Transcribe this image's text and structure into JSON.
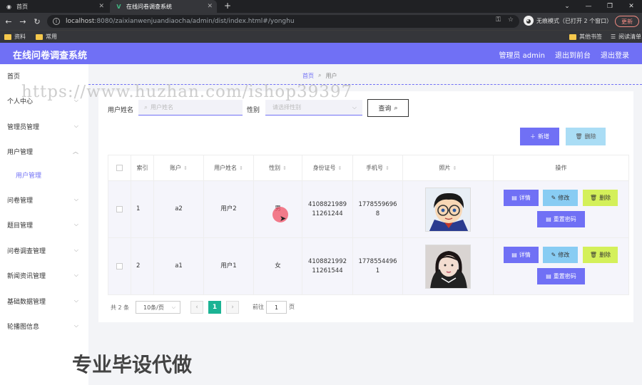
{
  "browser": {
    "tabs": [
      {
        "title": "首页"
      },
      {
        "title": "在线问卷调查系统"
      }
    ],
    "url_host": "localhost",
    "url_rest": ":8080/zaixianwenjuandiaocha/admin/dist/index.html#/yonghu",
    "incognito_label": "无痕模式（已打开 2 个窗口）",
    "update_label": "更新",
    "bookmarks": [
      "资料",
      "常用"
    ],
    "bookmarks_right": [
      "其他书签",
      "阅读清单"
    ]
  },
  "app": {
    "title": "在线问卷调查系统",
    "header_links": [
      "管理员 admin",
      "退出到前台",
      "退出登录"
    ]
  },
  "sidebar": {
    "items": [
      {
        "label": "首页",
        "chevron": false
      },
      {
        "label": "个人中心",
        "chevron": true
      },
      {
        "label": "管理员管理",
        "chevron": true
      },
      {
        "label": "用户管理",
        "chevron": true,
        "expanded": true
      },
      {
        "label": "用户管理",
        "sub": true
      },
      {
        "label": "问卷管理",
        "chevron": true
      },
      {
        "label": "题目管理",
        "chevron": true
      },
      {
        "label": "问卷调查管理",
        "chevron": true
      },
      {
        "label": "新闻资讯管理",
        "chevron": true
      },
      {
        "label": "基础数据管理",
        "chevron": true
      },
      {
        "label": "轮播图信息",
        "chevron": true
      }
    ]
  },
  "breadcrumb": {
    "home": "首页",
    "current": "用户"
  },
  "search": {
    "name_label": "用户姓名",
    "name_placeholder": "用户姓名",
    "gender_label": "性别",
    "gender_placeholder": "请选择性别",
    "query_label": "查询"
  },
  "actions": {
    "add_label": "新增",
    "delete_label": "删除"
  },
  "table": {
    "columns": [
      "索引",
      "账户",
      "用户姓名",
      "性别",
      "身份证号",
      "手机号",
      "照片",
      "操作"
    ],
    "rows": [
      {
        "index": "1",
        "account": "a2",
        "name": "用户2",
        "gender": "男",
        "id_line1": "4108821989",
        "id_line2": "11261244",
        "phone_line1": "1778559696",
        "phone_line2": "8"
      },
      {
        "index": "2",
        "account": "a1",
        "name": "用户1",
        "gender": "女",
        "id_line1": "4108821992",
        "id_line2": "11261544",
        "phone_line1": "1778554496",
        "phone_line2": "1"
      }
    ],
    "row_buttons": {
      "detail": "详情",
      "edit": "修改",
      "delete": "删除",
      "reset": "重置密码"
    }
  },
  "pagination": {
    "total": "共 2 条",
    "page_size": "10条/页",
    "current_page": "1",
    "goto_label": "前往",
    "goto_value": "1",
    "page_suffix": "页"
  },
  "watermark": {
    "url": "https://www.huzhan.com/ishop39397",
    "text": "专业毕设代做"
  },
  "colors": {
    "accent": "#7070f5",
    "page_active": "#1bb394"
  }
}
